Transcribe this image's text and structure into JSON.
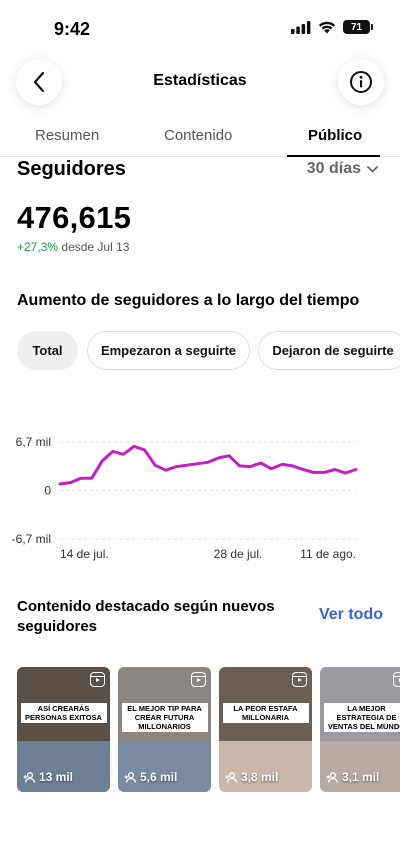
{
  "status_bar": {
    "time": "9:42",
    "battery": "71"
  },
  "header": {
    "title": "Estadísticas"
  },
  "tabs": [
    {
      "label": "Resumen"
    },
    {
      "label": "Contenido"
    },
    {
      "label": "Público"
    }
  ],
  "followers": {
    "title": "Seguidores",
    "period": "30 días",
    "total": "476,615",
    "growth_pct": "+27,3%",
    "growth_since": "desde Jul 13"
  },
  "chart_section": {
    "heading": "Aumento de seguidores a lo largo del tiempo",
    "filters": [
      "Total",
      "Empezaron a seguirte",
      "Dejaron de seguirte"
    ],
    "selected_filter": "Total"
  },
  "chart_data": {
    "type": "line",
    "y_tick_labels": [
      "6,7 mil",
      "0",
      "-6,7 mil"
    ],
    "y_ticks": [
      6700,
      0,
      -6700
    ],
    "ylim": [
      -6700,
      6700
    ],
    "x_tick_labels": [
      "14 de jul.",
      "28 de jul.",
      "11 de ago."
    ],
    "series": [
      {
        "color": "#c41ec4",
        "values": [
          900,
          1100,
          1700,
          1700,
          4100,
          5400,
          5000,
          6100,
          5600,
          3500,
          2800,
          3300,
          3500,
          3700,
          3900,
          4500,
          4800,
          3400,
          3300,
          3800,
          3000,
          3600,
          3400,
          2900,
          2500,
          2500,
          2900,
          2400,
          2900
        ]
      }
    ]
  },
  "featured": {
    "title": "Contenido destacado según nuevos seguidores",
    "see_all": "Ver todo",
    "items": [
      {
        "caption": "ASÍ CREARÁS PERSONAS EXITOSA",
        "count": "13 mil",
        "top_color": "#5a5048",
        "bottom_color": "#6f7f96"
      },
      {
        "caption": "EL MEJOR TIP PARA CREAR FUTURA MILLONARIOS",
        "count": "5,6 mil",
        "top_color": "#8b8682",
        "bottom_color": "#7a8aa3"
      },
      {
        "caption": "LA PEOR ESTAFA MILLONARIA",
        "count": "3,8 mil",
        "top_color": "#6b5e55",
        "bottom_color": "#c9b7aa"
      },
      {
        "caption": "LA MEJOR ESTRATEGIA DE VENTAS DEL MUNDO",
        "count": "3,1 mil",
        "top_color": "#9a9aa0",
        "bottom_color": "#b7aaa3"
      }
    ]
  }
}
